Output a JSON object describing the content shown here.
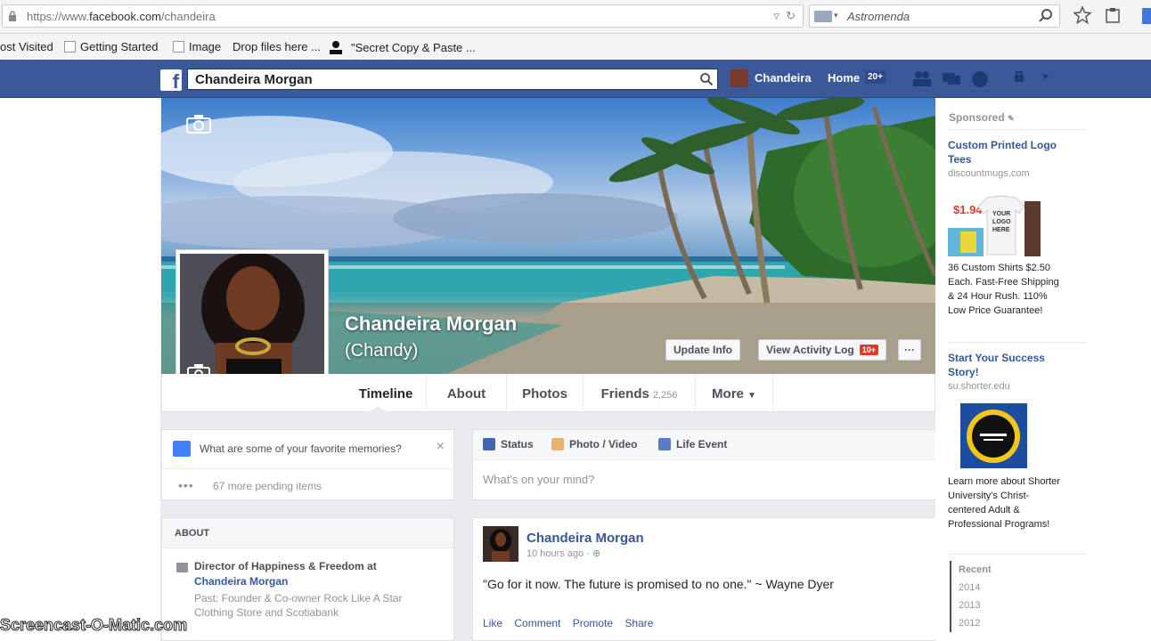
{
  "browser": {
    "url_prefix": "https://www.",
    "url_domain": "facebook.com",
    "url_path": "/chandeira",
    "search_placeholder": "Astromenda",
    "bookmarks": [
      "ost Visited",
      "Getting Started",
      "Image",
      "Drop files here ...",
      "\"Secret Copy & Paste ..."
    ]
  },
  "fb": {
    "search_value": "Chandeira Morgan",
    "user_name": "Chandeira",
    "home_label": "Home",
    "home_count": "20+"
  },
  "profile": {
    "name": "Chandeira Morgan",
    "nickname": "(Chandy)",
    "update_info": "Update Info",
    "activity_log": "View Activity Log",
    "activity_badge": "10+",
    "more_dots": "···",
    "tabs": [
      {
        "label": "Timeline"
      },
      {
        "label": "About"
      },
      {
        "label": "Photos"
      },
      {
        "label": "Friends",
        "count": "2,256"
      },
      {
        "label": "More"
      }
    ]
  },
  "memories": {
    "prompt": "What are some of your favorite memories?",
    "close": "×",
    "pending": "67 more pending items",
    "dots": "•••"
  },
  "about": {
    "header": "ABOUT",
    "job_line1": "Director of Happiness & Freedom at",
    "job_line2": "Chandeira Morgan",
    "past": "Past: Founder & Co-owner Rock Like A Star Clothing Store and Scotiabank"
  },
  "composer": {
    "tabs": [
      "Status",
      "Photo / Video",
      "Life Event"
    ],
    "placeholder": "What's on your mind?"
  },
  "post": {
    "author": "Chandeira Morgan",
    "time": "10 hours ago",
    "text": "\"Go for it now. The future is promised to no one.\" ~ Wayne Dyer",
    "actions": [
      "Like",
      "Comment",
      "Promote",
      "Share"
    ]
  },
  "sidebar": {
    "sponsored": "Sponsored",
    "ad1_title": "Custom Printed Logo Tees",
    "ad1_domain": "discountmugs.com",
    "ad1_price": "$1.94",
    "ad1_shirt_text": "YOUR LOGO HERE",
    "ad1_body": "36 Custom Shirts $2.50 Each. Fast-Free Shipping & 24 Hour Rush. 110% Low Price Guarantee!",
    "ad2_title": "Start Your Success Story!",
    "ad2_domain": "su.shorter.edu",
    "ad2_body": "Learn more about Shorter University's Christ-centered Adult & Professional Programs!",
    "years": [
      "Recent",
      "2014",
      "2013",
      "2012"
    ]
  },
  "watermark": "Screencast-O-Matic.com",
  "colors": {
    "fb_blue": "#3b5998",
    "link_blue": "#365899",
    "badge_red": "#e0392b"
  }
}
